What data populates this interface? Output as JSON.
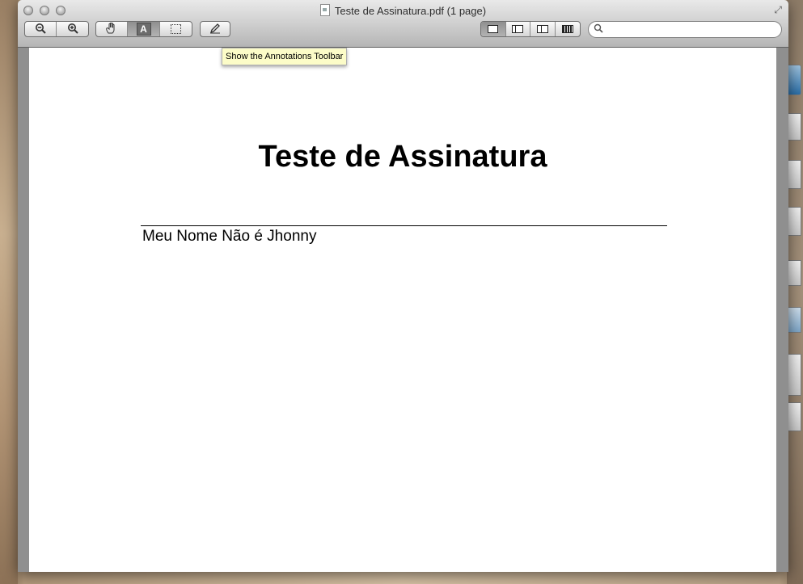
{
  "window": {
    "title": "Teste de Assinatura.pdf (1 page)"
  },
  "toolbar": {
    "icons": {
      "zoom_out": "zoom-out-icon",
      "zoom_in": "zoom-in-icon",
      "move": "hand-icon",
      "text_select": "text-select-icon",
      "rect_select": "rect-select-icon",
      "annotate": "pencil-icon",
      "content_only": "content-only-icon",
      "thumbnails": "thumbnails-icon",
      "table_of_contents": "toc-icon",
      "contact_sheet": "contact-sheet-icon",
      "search": "search-icon"
    },
    "search_value": ""
  },
  "tooltip": {
    "text": "Show the Annotations Toolbar"
  },
  "document": {
    "title": "Teste de Assinatura",
    "signature_name": "Meu Nome Não é Jhonny"
  }
}
